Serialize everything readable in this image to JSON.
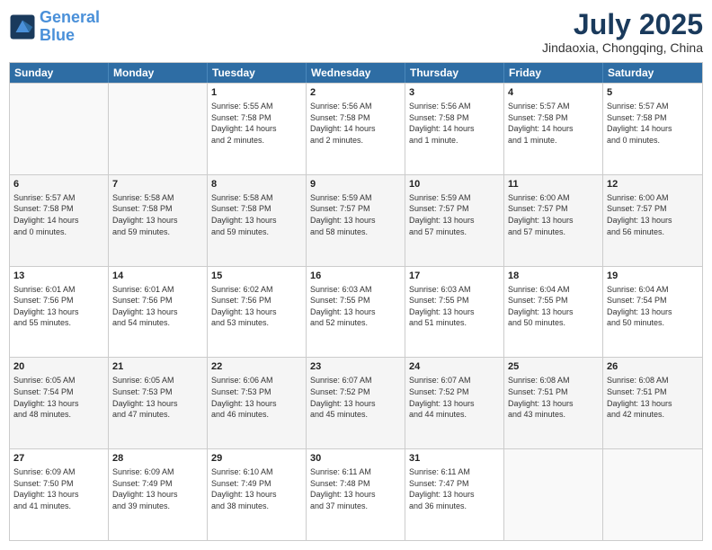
{
  "header": {
    "logo_line1": "General",
    "logo_line2": "Blue",
    "month": "July 2025",
    "location": "Jindaoxia, Chongqing, China"
  },
  "weekdays": [
    "Sunday",
    "Monday",
    "Tuesday",
    "Wednesday",
    "Thursday",
    "Friday",
    "Saturday"
  ],
  "rows": [
    [
      {
        "day": "",
        "info": ""
      },
      {
        "day": "",
        "info": ""
      },
      {
        "day": "1",
        "info": "Sunrise: 5:55 AM\nSunset: 7:58 PM\nDaylight: 14 hours\nand 2 minutes."
      },
      {
        "day": "2",
        "info": "Sunrise: 5:56 AM\nSunset: 7:58 PM\nDaylight: 14 hours\nand 2 minutes."
      },
      {
        "day": "3",
        "info": "Sunrise: 5:56 AM\nSunset: 7:58 PM\nDaylight: 14 hours\nand 1 minute."
      },
      {
        "day": "4",
        "info": "Sunrise: 5:57 AM\nSunset: 7:58 PM\nDaylight: 14 hours\nand 1 minute."
      },
      {
        "day": "5",
        "info": "Sunrise: 5:57 AM\nSunset: 7:58 PM\nDaylight: 14 hours\nand 0 minutes."
      }
    ],
    [
      {
        "day": "6",
        "info": "Sunrise: 5:57 AM\nSunset: 7:58 PM\nDaylight: 14 hours\nand 0 minutes."
      },
      {
        "day": "7",
        "info": "Sunrise: 5:58 AM\nSunset: 7:58 PM\nDaylight: 13 hours\nand 59 minutes."
      },
      {
        "day": "8",
        "info": "Sunrise: 5:58 AM\nSunset: 7:58 PM\nDaylight: 13 hours\nand 59 minutes."
      },
      {
        "day": "9",
        "info": "Sunrise: 5:59 AM\nSunset: 7:57 PM\nDaylight: 13 hours\nand 58 minutes."
      },
      {
        "day": "10",
        "info": "Sunrise: 5:59 AM\nSunset: 7:57 PM\nDaylight: 13 hours\nand 57 minutes."
      },
      {
        "day": "11",
        "info": "Sunrise: 6:00 AM\nSunset: 7:57 PM\nDaylight: 13 hours\nand 57 minutes."
      },
      {
        "day": "12",
        "info": "Sunrise: 6:00 AM\nSunset: 7:57 PM\nDaylight: 13 hours\nand 56 minutes."
      }
    ],
    [
      {
        "day": "13",
        "info": "Sunrise: 6:01 AM\nSunset: 7:56 PM\nDaylight: 13 hours\nand 55 minutes."
      },
      {
        "day": "14",
        "info": "Sunrise: 6:01 AM\nSunset: 7:56 PM\nDaylight: 13 hours\nand 54 minutes."
      },
      {
        "day": "15",
        "info": "Sunrise: 6:02 AM\nSunset: 7:56 PM\nDaylight: 13 hours\nand 53 minutes."
      },
      {
        "day": "16",
        "info": "Sunrise: 6:03 AM\nSunset: 7:55 PM\nDaylight: 13 hours\nand 52 minutes."
      },
      {
        "day": "17",
        "info": "Sunrise: 6:03 AM\nSunset: 7:55 PM\nDaylight: 13 hours\nand 51 minutes."
      },
      {
        "day": "18",
        "info": "Sunrise: 6:04 AM\nSunset: 7:55 PM\nDaylight: 13 hours\nand 50 minutes."
      },
      {
        "day": "19",
        "info": "Sunrise: 6:04 AM\nSunset: 7:54 PM\nDaylight: 13 hours\nand 50 minutes."
      }
    ],
    [
      {
        "day": "20",
        "info": "Sunrise: 6:05 AM\nSunset: 7:54 PM\nDaylight: 13 hours\nand 48 minutes."
      },
      {
        "day": "21",
        "info": "Sunrise: 6:05 AM\nSunset: 7:53 PM\nDaylight: 13 hours\nand 47 minutes."
      },
      {
        "day": "22",
        "info": "Sunrise: 6:06 AM\nSunset: 7:53 PM\nDaylight: 13 hours\nand 46 minutes."
      },
      {
        "day": "23",
        "info": "Sunrise: 6:07 AM\nSunset: 7:52 PM\nDaylight: 13 hours\nand 45 minutes."
      },
      {
        "day": "24",
        "info": "Sunrise: 6:07 AM\nSunset: 7:52 PM\nDaylight: 13 hours\nand 44 minutes."
      },
      {
        "day": "25",
        "info": "Sunrise: 6:08 AM\nSunset: 7:51 PM\nDaylight: 13 hours\nand 43 minutes."
      },
      {
        "day": "26",
        "info": "Sunrise: 6:08 AM\nSunset: 7:51 PM\nDaylight: 13 hours\nand 42 minutes."
      }
    ],
    [
      {
        "day": "27",
        "info": "Sunrise: 6:09 AM\nSunset: 7:50 PM\nDaylight: 13 hours\nand 41 minutes."
      },
      {
        "day": "28",
        "info": "Sunrise: 6:09 AM\nSunset: 7:49 PM\nDaylight: 13 hours\nand 39 minutes."
      },
      {
        "day": "29",
        "info": "Sunrise: 6:10 AM\nSunset: 7:49 PM\nDaylight: 13 hours\nand 38 minutes."
      },
      {
        "day": "30",
        "info": "Sunrise: 6:11 AM\nSunset: 7:48 PM\nDaylight: 13 hours\nand 37 minutes."
      },
      {
        "day": "31",
        "info": "Sunrise: 6:11 AM\nSunset: 7:47 PM\nDaylight: 13 hours\nand 36 minutes."
      },
      {
        "day": "",
        "info": ""
      },
      {
        "day": "",
        "info": ""
      }
    ]
  ]
}
